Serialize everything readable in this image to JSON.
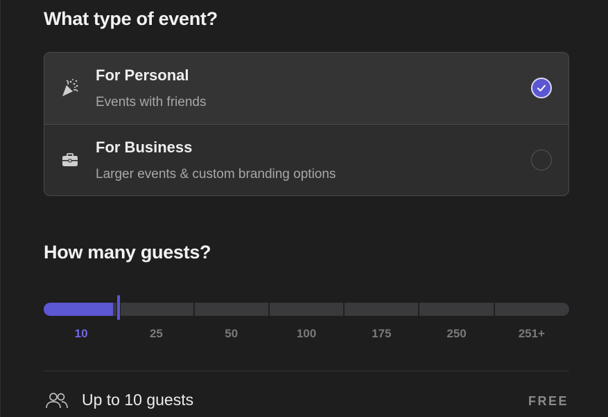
{
  "event_type": {
    "heading": "What type of event?",
    "options": [
      {
        "title": "For Personal",
        "description": "Events with friends",
        "icon": "party-popper-icon",
        "selected": true
      },
      {
        "title": "For Business",
        "description": "Larger events & custom branding options",
        "icon": "briefcase-icon",
        "selected": false
      }
    ]
  },
  "guests": {
    "heading": "How many guests?",
    "ticks": [
      "10",
      "25",
      "50",
      "100",
      "175",
      "250",
      "251+"
    ],
    "selected_index": 0,
    "summary_icon": "users-icon",
    "summary": "Up to 10 guests",
    "price": "FREE"
  },
  "colors": {
    "accent": "#5c57d3",
    "background": "#1e1e1e",
    "card": "#2d2d2d"
  }
}
